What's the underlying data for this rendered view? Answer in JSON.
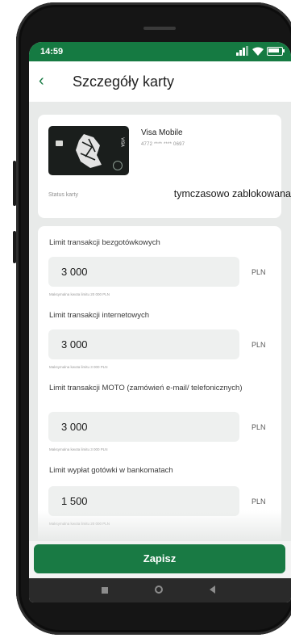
{
  "status_bar": {
    "time": "14:59"
  },
  "header": {
    "title": "Szczegóły karty"
  },
  "card": {
    "name": "Visa Mobile",
    "number": "4772 **** **** 0697",
    "brand_mark": "VISA",
    "status_label": "Status karty",
    "status_value": "tymczasowo zablokowana"
  },
  "limits": [
    {
      "label": "Limit transakcji bezgotówkowych",
      "value": "3 000",
      "currency": "PLN",
      "hint": "Maksymalna kwota limitu 20 000 PLN"
    },
    {
      "label": "Limit transakcji internetowych",
      "value": "3 000",
      "currency": "PLN",
      "hint": "Maksymalna kwota limitu 3 000 PLN"
    },
    {
      "label": "Limit transakcji MOTO (zamówień e-mail/ telefonicznych)",
      "value": "3 000",
      "currency": "PLN",
      "hint": "Maksymalna kwota limitu 3 000 PLN"
    },
    {
      "label": "Limit wypłat gotówki w bankomatach",
      "value": "1 500",
      "currency": "PLN",
      "hint": "Maksymalna kwota limitu 20 000 PLN"
    }
  ],
  "actions": {
    "save_label": "Zapisz"
  },
  "colors": {
    "brand": "#197a44",
    "background": "#e8eae9"
  },
  "icons": [
    "back-arrow-icon",
    "signal-icon",
    "wifi-icon",
    "battery-icon",
    "recent-apps-icon",
    "home-icon",
    "nav-back-icon"
  ]
}
